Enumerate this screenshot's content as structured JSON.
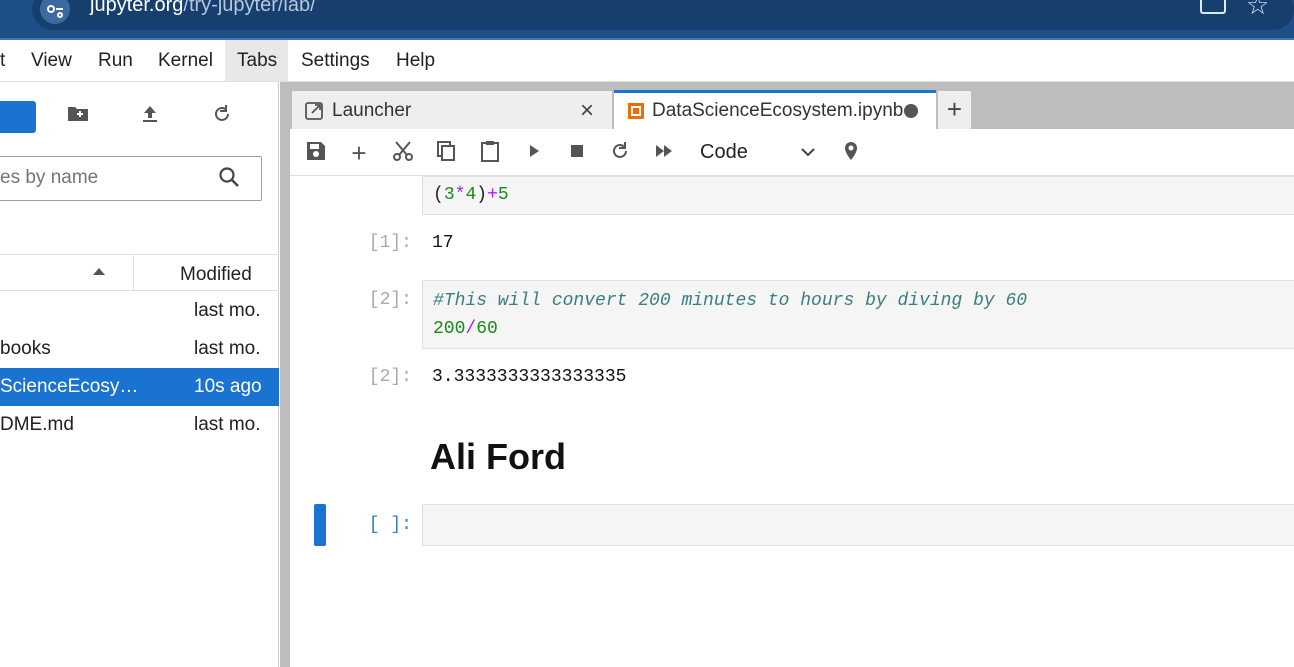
{
  "browser": {
    "url_host": "jupyter.org",
    "url_path": "/try-jupyter/lab/"
  },
  "menu": {
    "items": [
      "t",
      "View",
      "Run",
      "Kernel",
      "Tabs",
      "Settings",
      "Help"
    ],
    "active": "Tabs"
  },
  "file_browser": {
    "filter_placeholder": "es by name",
    "modified_header": "Modified",
    "files": [
      {
        "name": "",
        "modified": "last mo."
      },
      {
        "name": "books",
        "modified": "last mo."
      },
      {
        "name": "ScienceEcosy…",
        "modified": "10s ago",
        "selected": true
      },
      {
        "name": "DME.md",
        "modified": "last mo."
      }
    ]
  },
  "tabs": [
    {
      "label": "Launcher",
      "active": false
    },
    {
      "label": "DataScienceEcosystem.ipynb",
      "active": true,
      "unsaved": true
    }
  ],
  "toolbar": {
    "cell_type": "Code"
  },
  "cells": {
    "cell0_code": "(3*4)+5",
    "cell1_prompt": "[1]:",
    "cell1_output": "17",
    "cell2_prompt": "[2]:",
    "cell2_comment": "#This will convert 200 minutes to hours by diving by 60",
    "cell2_code_a": "200",
    "cell2_code_op": "/",
    "cell2_code_b": "60",
    "cell2_out_prompt": "[2]:",
    "cell2_output": "3.3333333333333335",
    "markdown_heading": "Ali Ford",
    "empty_prompt": "[ ]:"
  },
  "colors": {
    "accent": "#1a73d0",
    "browser_bar": "#1e4f86"
  }
}
